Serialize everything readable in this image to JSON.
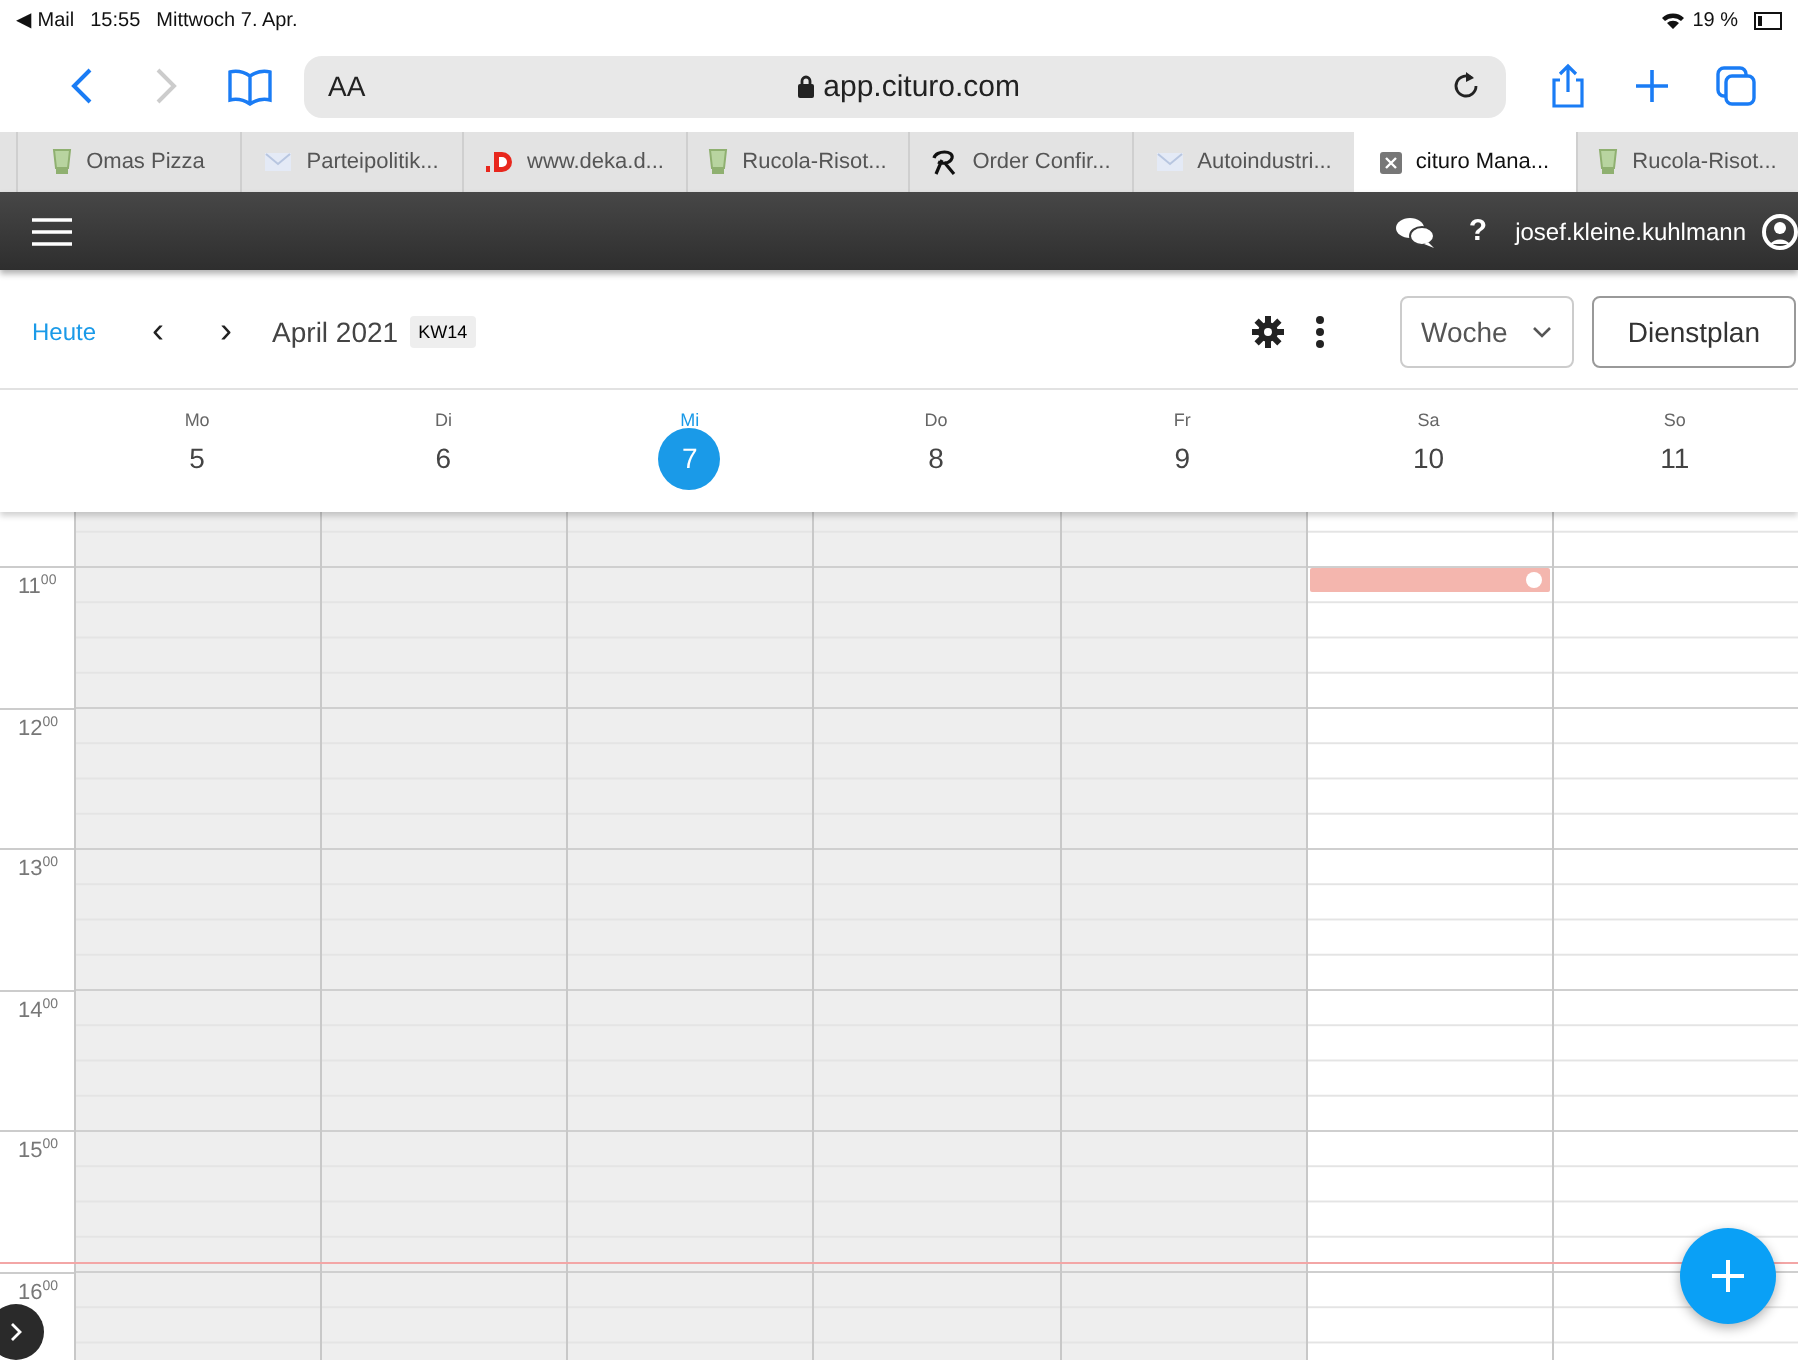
{
  "status_bar": {
    "back_app": "◀ Mail",
    "time": "15:55",
    "date": "Mittwoch 7. Apr.",
    "battery": "19 %"
  },
  "browser": {
    "back_enabled": true,
    "forward_enabled": false,
    "text_size": "AA",
    "address": "app.cituro.com"
  },
  "tabs": [
    {
      "label": "Omas Pizza",
      "kind": "recipe",
      "selected": false
    },
    {
      "label": "Parteipolitik...",
      "kind": "mail",
      "selected": false
    },
    {
      "label": "www.deka.d...",
      "kind": "bank",
      "selected": false
    },
    {
      "label": "Rucola-Risot...",
      "kind": "recipe",
      "selected": false
    },
    {
      "label": "Order Confir...",
      "kind": "order",
      "selected": false
    },
    {
      "label": "Autoindustri...",
      "kind": "mail",
      "selected": false
    },
    {
      "label": "cituro Mana...",
      "kind": "app",
      "selected": true
    },
    {
      "label": "Rucola-Risot...",
      "kind": "recipe",
      "selected": false
    }
  ],
  "app_bar": {
    "help": "?",
    "user": "josef.kleine.kuhlmann"
  },
  "toolbar": {
    "today": "Heute",
    "prev": "‹",
    "next": "›",
    "month": "April 2021",
    "week": "KW14",
    "view": "Woche",
    "roster_button": "Dienstplan"
  },
  "days": [
    {
      "weekday": "Mo",
      "date": "5",
      "selected": false,
      "available": false
    },
    {
      "weekday": "Di",
      "date": "6",
      "selected": false,
      "available": false
    },
    {
      "weekday": "Mi",
      "date": "7",
      "selected": true,
      "available": false
    },
    {
      "weekday": "Do",
      "date": "8",
      "selected": false,
      "available": false
    },
    {
      "weekday": "Fr",
      "date": "9",
      "selected": false,
      "available": false
    },
    {
      "weekday": "Sa",
      "date": "10",
      "selected": false,
      "available": true,
      "appointment": true
    },
    {
      "weekday": "So",
      "date": "11",
      "selected": false,
      "available": true
    }
  ],
  "hours": [
    {
      "label": "11$^{00}$",
      "now_line": false
    },
    {
      "label": "12$^{00}$",
      "now_line": false
    },
    {
      "label": "13$^{00}$",
      "now_line": false
    },
    {
      "label": "14$^{00}$",
      "now_line": false
    },
    {
      "label": "15$^{00}$",
      "now_line": true
    },
    {
      "label": "16$^{00}$",
      "now_line": false
    }
  ]
}
